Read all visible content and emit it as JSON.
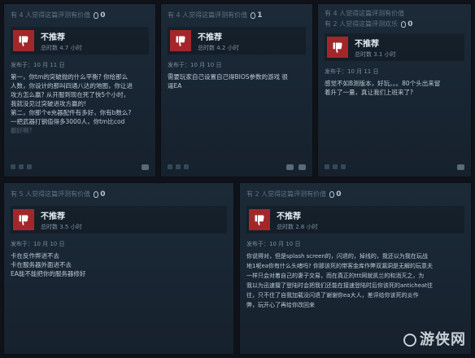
{
  "reviews": [
    {
      "helpful": "有 4 人觉得这篇评测有价值",
      "awards": "0",
      "verdict": "不推荐",
      "hours": "总时数 4.7 小时",
      "posted": "发布于：10 月 11 日",
      "body": [
        "第一，你tm的突破抛的什么平衡? 你给那么",
        "人数，你设计的那叫四通八达的地图，你让进",
        "攻方怎么赢? 从开服到现在死了快5个小时，",
        "我就没见过突破进攻方赢的!",
        "第二，你那个e充器配件有多好，你有b数么?",
        "一把武器打钢值得多3000人，你tm比cod",
        "都好啊?"
      ]
    },
    {
      "helpful": "有 4 人觉得这篇评测有价值",
      "awards": "1",
      "verdict": "不推荐",
      "hours": "总时数 4.2 小时",
      "posted": "发布于：10 月 10 日",
      "body": [
        "需要玩家自己设置自己得BIOS参数的游戏 很",
        "逼EA"
      ]
    },
    {
      "helpful": "有 4 人觉得这篇评测有价值",
      "helpful2": "有 2 人觉得这篇评测欢乐",
      "awards": "0",
      "verdict": "不推荐",
      "hours": "总时数 3.1 小时",
      "posted": "发布于：10 月 11 日",
      "body": [
        "感觉不如B测版本，好玩。。。80个头出来留",
        "着升了一量，真让我们上班来了?"
      ]
    },
    {
      "helpful": "有 5 人觉得这篇评测有价值",
      "awards": "0",
      "verdict": "不推荐",
      "hours": "总时数 3.5 小时",
      "posted": "发布于：10 月 10 日",
      "body": [
        "卡在反作弊进不去",
        "卡在服务器外面进不去",
        "EA能不能把你的服务器修好"
      ]
    },
    {
      "helpful": "有 2 人觉得这篇评测有价值",
      "awards": "0",
      "verdict": "不推荐",
      "hours": "总时数 2.8 小时",
      "posted": "发布于：10 月 10 日",
      "body": [
        "你说得对，但是splash screen的，闪退的，掉线的，我还以为我在玩战",
        "地1呢ea你有什么头绪吗? 你那该死的带客金库作弊双漏洞是无解的玩意夫",
        "一样只会对着自己的妻子交易，而在真正的ttt网就凯兰的和消灭之，为",
        "我以为迅速擅了登陆时会把我们还能在接速登陆时后你该死的anticheat往",
        "往，只不住了自我加载没闪退了谢谢你ea大人，差评给你该死的炎作",
        "弊，玩开心了再给你改回来"
      ]
    }
  ],
  "watermark": "游侠网"
}
